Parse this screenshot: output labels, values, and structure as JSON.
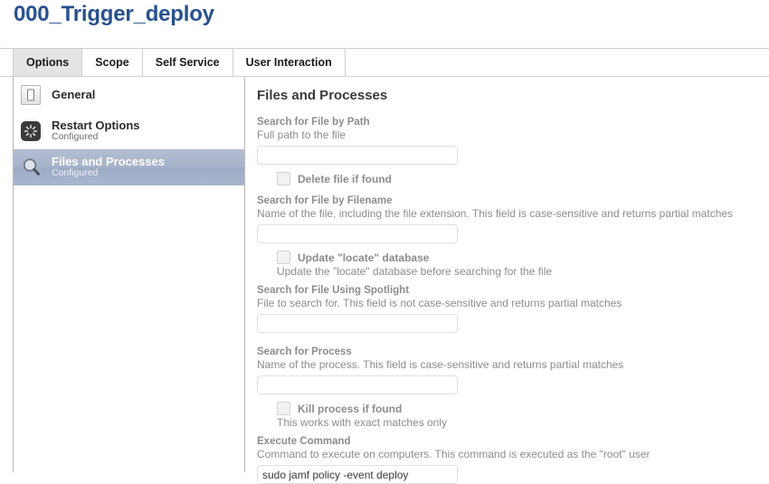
{
  "page": {
    "title": "000_Trigger_deploy"
  },
  "tabs": [
    {
      "label": "Options",
      "active": true
    },
    {
      "label": "Scope",
      "active": false
    },
    {
      "label": "Self Service",
      "active": false
    },
    {
      "label": "User Interaction",
      "active": false
    }
  ],
  "sidebar": {
    "items": [
      {
        "icon": "general-icon",
        "label": "General",
        "status": ""
      },
      {
        "icon": "restart-icon",
        "label": "Restart Options",
        "status": "Configured"
      },
      {
        "icon": "search-icon",
        "label": "Files and Processes",
        "status": "Configured"
      }
    ]
  },
  "content": {
    "title": "Files and Processes",
    "fields": {
      "file_by_path": {
        "label": "Search for File by Path",
        "help": "Full path to the file",
        "value": "",
        "placeholder": ""
      },
      "delete_file": {
        "label": "Delete file if found",
        "checked": false
      },
      "file_by_filename": {
        "label": "Search for File by Filename",
        "help": "Name of the file, including the file extension. This field is case-sensitive and returns partial matches",
        "value": "",
        "placeholder": ""
      },
      "update_locate": {
        "label": "Update \"locate\" database",
        "help": "Update the \"locate\" database before searching for the file",
        "checked": false
      },
      "file_spotlight": {
        "label": "Search for File Using Spotlight",
        "help": "File to search for. This field is not case-sensitive and returns partial matches",
        "value": "",
        "placeholder": ""
      },
      "search_process": {
        "label": "Search for Process",
        "help": "Name of the process. This field is case-sensitive and returns partial matches",
        "value": "",
        "placeholder": ""
      },
      "kill_process": {
        "label": "Kill process if found",
        "help": "This works with exact matches only",
        "checked": false
      },
      "execute_command": {
        "label": "Execute Command",
        "help": "Command to execute on computers. This command is executed as the \"root\" user",
        "value": "sudo jamf policy -event deploy",
        "placeholder": ""
      }
    }
  },
  "colors": {
    "title": "#27518f",
    "selected_row": "#a6b2ca",
    "label_grey": "#8d8d8d",
    "heading": "#3a3a3a"
  }
}
